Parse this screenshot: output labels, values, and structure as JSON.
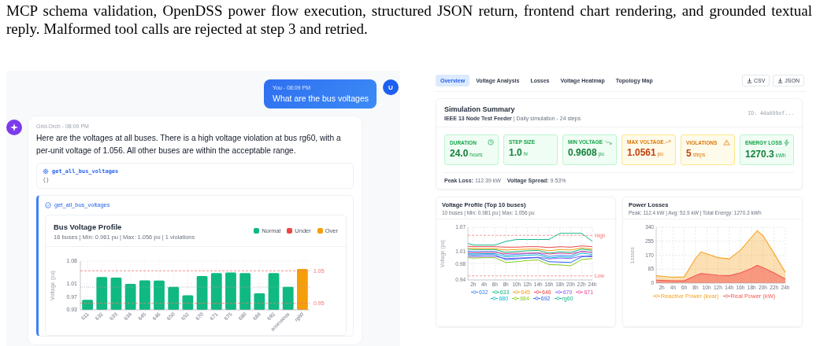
{
  "caption": "MCP schema validation, OpenDSS power flow execution, structured JSON return, frontend chart rendering, and grounded textual reply. Malformed tool calls are rejected at step 3 and retried.",
  "chat": {
    "user": {
      "meta": "You - 08:09 PM",
      "text": "What are the bus voltages",
      "avatar": "U"
    },
    "assistant": {
      "meta": "Grid-Orch - 08:09 PM",
      "text": "Here are the voltages at all buses. There is a high voltage violation at bus rg60, with a per-unit voltage of 1.056. All other buses are within the acceptable range.",
      "tool_call": {
        "name": "get_all_bus_voltages",
        "args": "{}"
      },
      "result": {
        "name": "get_all_bus_voltages",
        "title": "Bus Voltage Profile",
        "subtitle": "16 buses | Min: 0.961 pu | Max: 1.056 pu | 1 violations",
        "legend": [
          {
            "label": "Normal",
            "kind": "normal",
            "color": "#10b981"
          },
          {
            "label": "Under",
            "kind": "under",
            "color": "#ef4444"
          },
          {
            "label": "Over",
            "kind": "over",
            "color": "#f59e0b"
          }
        ],
        "chart_data": {
          "type": "bar",
          "ylabel": "Voltage (pu)",
          "grid": true,
          "categories": [
            "611",
            "632",
            "633",
            "634",
            "645",
            "646",
            "650",
            "652",
            "670",
            "671",
            "675",
            "680",
            "684",
            "692",
            "sourcebus",
            "rg60"
          ],
          "values": [
            0.961,
            1.031,
            1.029,
            1.01,
            1.021,
            1.02,
            1.001,
            0.975,
            1.034,
            1.043,
            1.045,
            1.043,
            0.981,
            1.043,
            1.001,
            1.056
          ],
          "ylim": [
            0.93,
            1.08
          ],
          "yticks": [
            0.93,
            0.97,
            1.01,
            1.08
          ],
          "ref_lines": [
            {
              "axis": "y",
              "value": 1.05,
              "label": "1.05"
            },
            {
              "axis": "y",
              "value": 0.95,
              "label": "0.95"
            },
            {
              "axis": "y",
              "value": 1.0
            }
          ]
        }
      }
    }
  },
  "dashboard": {
    "tabs": [
      {
        "label": "Overview",
        "selected": true
      },
      {
        "label": "Voltage Analysis",
        "selected": false
      },
      {
        "label": "Losses",
        "selected": false
      },
      {
        "label": "Voltage Heatmap",
        "selected": false
      },
      {
        "label": "Topology Map",
        "selected": false
      }
    ],
    "exports": [
      "CSV",
      "JSON"
    ],
    "summary": {
      "title": "Simulation Summary",
      "subtitle": "**IEEE 13 Node Test Feeder** | Daily simulation - 24 steps",
      "id": "ID: 4da699ef...",
      "metrics": [
        {
          "label": "DURATION",
          "value": "24.0",
          "unit": "hours",
          "warning": false
        },
        {
          "label": "STEP SIZE",
          "value": "1.0",
          "unit": "hr",
          "warning": false
        },
        {
          "label": "MIN VOLTAGE",
          "value": "0.9608",
          "unit": "pu",
          "warning": false
        },
        {
          "label": "MAX VOLTAGE",
          "value": "1.0561",
          "unit": "pu",
          "warning": true
        },
        {
          "label": "VIOLATIONS",
          "value": "5",
          "unit": "steps",
          "warning": true
        },
        {
          "label": "ENERGY LOSS",
          "value": "1270.3",
          "unit": "kWh",
          "warning": false
        }
      ],
      "footer": [
        "**Peak Loss:** 112.39 kW",
        "**Voltage Spread:** 9.53%"
      ]
    },
    "voltage_profile": {
      "title": "Voltage Profile (Top 10 buses)",
      "subtitle": "10 buses | Min: 0.981 pu | Max: 1.056 pu",
      "chart_data": {
        "type": "line",
        "ylabel": "Voltage (pu)",
        "grid": true,
        "legend": "bottom",
        "x": [
          1,
          2,
          4,
          6,
          8,
          10,
          12,
          14,
          16,
          18,
          20,
          22,
          24
        ],
        "xlim": [
          1,
          24
        ],
        "ylim": [
          0.94,
          1.07
        ],
        "xticks": [
          {
            "value": 2,
            "label": "2h"
          },
          {
            "value": 4,
            "label": "4h"
          },
          {
            "value": 6,
            "label": "6h"
          },
          {
            "value": 8,
            "label": "8h"
          },
          {
            "value": 10,
            "label": "10h"
          },
          {
            "value": 12,
            "label": "12h"
          },
          {
            "value": 14,
            "label": "14h"
          },
          {
            "value": 16,
            "label": "16h"
          },
          {
            "value": 18,
            "label": "18h"
          },
          {
            "value": 20,
            "label": "20h"
          },
          {
            "value": 22,
            "label": "22h"
          },
          {
            "value": 24,
            "label": "24h"
          }
        ],
        "yticks": [
          0.94,
          0.98,
          1.01,
          1.07
        ],
        "ref_lines": [
          {
            "axis": "y",
            "value": 1.05,
            "label": "High"
          },
          {
            "axis": "y",
            "value": 0.95,
            "label": "Low"
          }
        ],
        "series": [
          {
            "name": "632",
            "color": "#3b82f6",
            "values": [
              1.011,
              1.01,
              1.01,
              1.01,
              1.001,
              1.003,
              1.005,
              1.006,
              0.998,
              1.001,
              1.0,
              1.011,
              1.008
            ]
          },
          {
            "name": "633",
            "color": "#10b981",
            "values": [
              1.016,
              1.015,
              1.015,
              1.015,
              1.008,
              1.01,
              1.012,
              1.013,
              1.006,
              1.009,
              1.008,
              1.016,
              1.013
            ]
          },
          {
            "name": "645",
            "color": "#f59e0b",
            "values": [
              1.018,
              1.017,
              1.017,
              1.017,
              1.014,
              1.015,
              1.016,
              1.016,
              1.012,
              1.015,
              1.014,
              1.019,
              1.016
            ]
          },
          {
            "name": "646",
            "color": "#ef4444",
            "values": [
              1.023,
              1.022,
              1.022,
              1.022,
              1.021,
              1.021,
              1.022,
              1.022,
              1.02,
              1.022,
              1.021,
              1.024,
              1.022
            ]
          },
          {
            "name": "670",
            "color": "#8b5cf6",
            "values": [
              0.998,
              0.997,
              0.998,
              0.998,
              0.993,
              0.994,
              0.995,
              0.996,
              0.992,
              0.994,
              0.993,
              0.999,
              0.997
            ]
          },
          {
            "name": "671",
            "color": "#ec4899",
            "values": [
              1.008,
              1.007,
              1.008,
              1.008,
              1.005,
              1.006,
              1.006,
              1.007,
              1.004,
              1.006,
              1.005,
              1.01,
              1.008
            ]
          },
          {
            "name": "680",
            "color": "#06b6d4",
            "values": [
              1.005,
              1.004,
              1.005,
              1.005,
              0.997,
              0.999,
              1.001,
              1.002,
              0.994,
              0.997,
              0.996,
              1.006,
              1.003
            ]
          },
          {
            "name": "684",
            "color": "#84cc16",
            "values": [
              0.995,
              0.994,
              0.995,
              0.995,
              0.983,
              0.985,
              0.988,
              0.989,
              0.978,
              0.977,
              0.975,
              0.99,
              0.993
            ]
          },
          {
            "name": "692",
            "color": "#2563eb",
            "values": [
              1.002,
              1.001,
              1.002,
              1.002,
              0.99,
              0.992,
              0.994,
              0.995,
              0.985,
              0.984,
              0.983,
              0.997,
              1.0
            ]
          },
          {
            "name": "rg60",
            "color": "#14b88a",
            "values": [
              1.03,
              1.026,
              1.026,
              1.026,
              1.035,
              1.04,
              1.04,
              1.04,
              1.04,
              1.055,
              1.055,
              1.055,
              1.035
            ]
          }
        ]
      }
    },
    "power_losses": {
      "title": "Power Losses",
      "subtitle": "Peak: 112.4 kW | Avg: 52.9 kW | Total Energy: 1270.3 kWh",
      "chart_data": {
        "type": "area",
        "ylabel": "Losses",
        "grid": true,
        "legend": "bottom",
        "x": [
          1,
          2,
          4,
          6,
          8,
          9,
          10,
          12,
          14,
          16,
          18,
          19,
          20,
          22,
          24
        ],
        "xlim": [
          1,
          24
        ],
        "ylim": [
          0,
          340
        ],
        "xticks": [
          {
            "value": 2,
            "label": "2h"
          },
          {
            "value": 4,
            "label": "4h"
          },
          {
            "value": 6,
            "label": "6h"
          },
          {
            "value": 8,
            "label": "8h"
          },
          {
            "value": 10,
            "label": "10h"
          },
          {
            "value": 12,
            "label": "12h"
          },
          {
            "value": 14,
            "label": "14h"
          },
          {
            "value": 16,
            "label": "16h"
          },
          {
            "value": 18,
            "label": "18h"
          },
          {
            "value": 20,
            "label": "20h"
          },
          {
            "value": 22,
            "label": "22h"
          },
          {
            "value": 24,
            "label": "24h"
          }
        ],
        "yticks": [
          0,
          85,
          170,
          255,
          340
        ],
        "series": [
          {
            "name": "Reactive Power (kvar)",
            "color": "#f5a524",
            "values": [
              45,
              42,
              36,
              38,
              150,
              190,
              178,
              155,
              148,
              200,
              280,
              318,
              290,
              180,
              65
            ]
          },
          {
            "name": "Real Power (kW)",
            "color": "#f25c54",
            "values": [
              18,
              17,
              14,
              14,
              45,
              58,
              55,
              48,
              45,
              62,
              90,
              108,
              95,
              62,
              25
            ]
          }
        ]
      }
    }
  }
}
